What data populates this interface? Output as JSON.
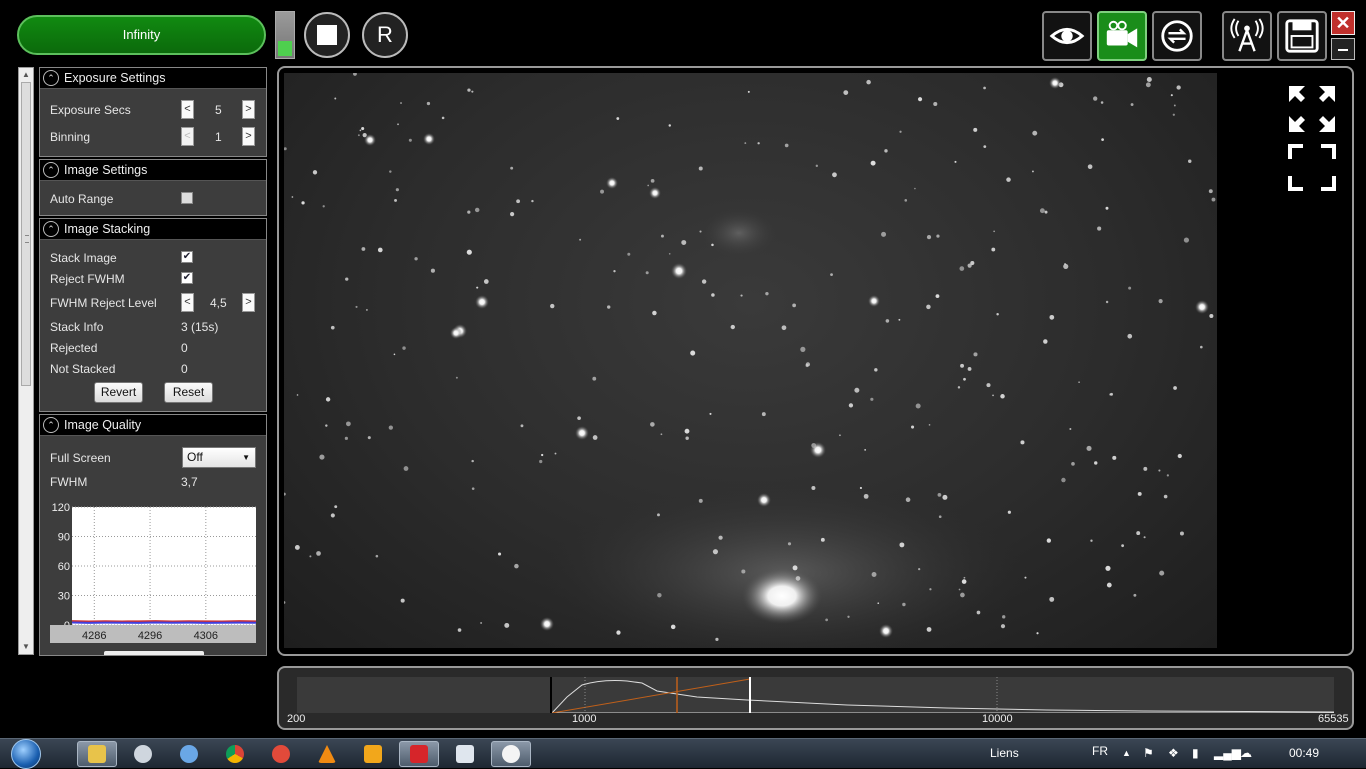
{
  "toolbar": {
    "mode_label": "Infinity",
    "restart_label": "R",
    "level_fraction": 0.35
  },
  "exposure_settings": {
    "title": "Exposure Settings",
    "exposure_label": "Exposure Secs",
    "exposure_value": "5",
    "binning_label": "Binning",
    "binning_value": "1"
  },
  "image_settings": {
    "title": "Image Settings",
    "auto_range_label": "Auto Range",
    "auto_range_checked": false
  },
  "image_stacking": {
    "title": "Image Stacking",
    "stack_image_label": "Stack Image",
    "stack_image_checked": true,
    "reject_fwhm_label": "Reject FWHM",
    "reject_fwhm_checked": true,
    "reject_level_label": "FWHM Reject Level",
    "reject_level_value": "4,5",
    "stack_info_label": "Stack Info",
    "stack_info_value": "3 (15s)",
    "rejected_label": "Rejected",
    "rejected_value": "0",
    "not_stacked_label": "Not Stacked",
    "not_stacked_value": "0",
    "revert_label": "Revert",
    "reset_label": "Reset"
  },
  "image_quality": {
    "title": "Image Quality",
    "full_screen_label": "Full Screen",
    "full_screen_value": "Off",
    "fwhm_label": "FWHM",
    "fwhm_value": "3,7"
  },
  "chart_data": {
    "type": "line",
    "title": "",
    "xlabel": "",
    "ylabel": "",
    "x_ticks": [
      "4286",
      "4296",
      "4306"
    ],
    "y_ticks": [
      "0",
      "30",
      "60",
      "90",
      "120"
    ],
    "ylim": [
      0,
      120
    ],
    "xlim": [
      4282,
      4315
    ],
    "grid": true,
    "series": [
      {
        "color": "#d03030",
        "x": [
          4282,
          4285,
          4288,
          4291,
          4294,
          4297,
          4300,
          4303,
          4306,
          4309,
          4312,
          4315
        ],
        "values": [
          4,
          3.5,
          3.8,
          3.6,
          3.7,
          3.9,
          3.6,
          3.8,
          3.7,
          3.6,
          3.9,
          3.7
        ]
      },
      {
        "color": "#4040e0",
        "x": [
          4282,
          4285,
          4288,
          4291,
          4294,
          4297,
          4300,
          4303,
          4306,
          4309,
          4312,
          4315
        ],
        "values": [
          2.5,
          2.2,
          2.4,
          2.3,
          2.2,
          2.5,
          2.3,
          2.4,
          2.2,
          2.3,
          2.4,
          2.3
        ]
      }
    ]
  },
  "histogram": {
    "labels": [
      "200",
      "1000",
      "10000",
      "65535"
    ]
  },
  "taskbar": {
    "links_label": "Liens",
    "lang_label": "FR",
    "clock": "00:49"
  },
  "colors": {
    "accent_green": "#118a11",
    "panel_bg": "#3d3d3d"
  },
  "icons": [
    "eye-icon",
    "camera-icon",
    "loop-icon",
    "antenna-icon",
    "save-icon",
    "close-icon",
    "minimize-icon"
  ]
}
